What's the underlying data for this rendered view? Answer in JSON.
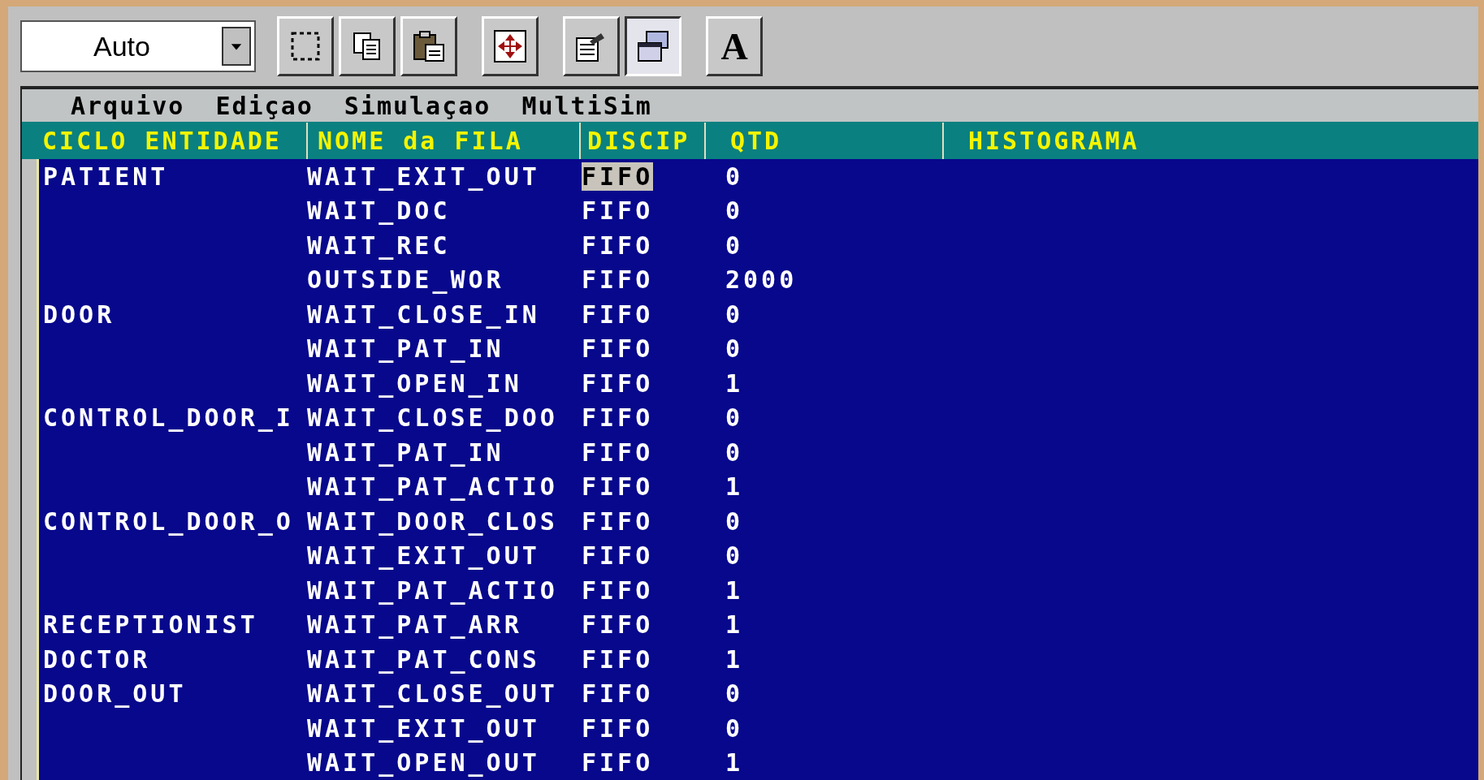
{
  "toolbar": {
    "combo": {
      "value": "Auto"
    },
    "buttons": [
      {
        "kind": "select",
        "pressed": false
      },
      {
        "kind": "copy",
        "pressed": false
      },
      {
        "kind": "paste",
        "pressed": false
      },
      {
        "kind": "move",
        "pressed": false
      },
      {
        "kind": "properties",
        "pressed": false
      },
      {
        "kind": "windows",
        "pressed": true
      },
      {
        "kind": "text",
        "label": "A",
        "pressed": false
      }
    ]
  },
  "menu": [
    "Arquivo",
    "Ediçao",
    "Simulaçao",
    "MultiSim"
  ],
  "table": {
    "columns": [
      "CICLO ENTIDADE",
      "NOME da FILA",
      "DISCIP",
      "QTD",
      "HISTOGRAMA"
    ],
    "rows": [
      {
        "entity": "PATIENT",
        "queue": "WAIT_EXIT_OUT",
        "discipline": "FIFO",
        "qtd": "0",
        "selected": true
      },
      {
        "queue": "WAIT_DOC",
        "discipline": "FIFO",
        "qtd": "0",
        "selected": false
      },
      {
        "queue": "WAIT_REC",
        "discipline": "FIFO",
        "qtd": "0",
        "selected": false
      },
      {
        "queue": "OUTSIDE_WOR",
        "discipline": "FIFO",
        "qtd": "2000",
        "selected": false
      },
      {
        "entity": "DOOR",
        "queue": "WAIT_CLOSE_IN",
        "discipline": "FIFO",
        "qtd": "0",
        "selected": false
      },
      {
        "queue": "WAIT_PAT_IN",
        "discipline": "FIFO",
        "qtd": "0",
        "selected": false
      },
      {
        "queue": "WAIT_OPEN_IN",
        "discipline": "FIFO",
        "qtd": "1",
        "selected": false
      },
      {
        "entity": "CONTROL_DOOR_I",
        "queue": "WAIT_CLOSE_DOO",
        "discipline": "FIFO",
        "qtd": "0",
        "selected": false
      },
      {
        "queue": "WAIT_PAT_IN",
        "discipline": "FIFO",
        "qtd": "0",
        "selected": false
      },
      {
        "queue": "WAIT_PAT_ACTIO",
        "discipline": "FIFO",
        "qtd": "1",
        "selected": false
      },
      {
        "entity": "CONTROL_DOOR_O",
        "queue": "WAIT_DOOR_CLOS",
        "discipline": "FIFO",
        "qtd": "0",
        "selected": false
      },
      {
        "queue": "WAIT_EXIT_OUT",
        "discipline": "FIFO",
        "qtd": "0",
        "selected": false
      },
      {
        "queue": "WAIT_PAT_ACTIO",
        "discipline": "FIFO",
        "qtd": "1",
        "selected": false
      },
      {
        "entity": "RECEPTIONIST",
        "queue": "WAIT_PAT_ARR",
        "discipline": "FIFO",
        "qtd": "1",
        "selected": false
      },
      {
        "entity": "DOCTOR",
        "queue": "WAIT_PAT_CONS",
        "discipline": "FIFO",
        "qtd": "1",
        "selected": false
      },
      {
        "entity": "DOOR_OUT",
        "queue": "WAIT_CLOSE_OUT",
        "discipline": "FIFO",
        "qtd": "0",
        "selected": false
      },
      {
        "queue": "WAIT_EXIT_OUT",
        "discipline": "FIFO",
        "qtd": "0",
        "selected": false
      },
      {
        "queue": "WAIT_OPEN_OUT",
        "discipline": "FIFO",
        "qtd": "1",
        "selected": false
      }
    ]
  }
}
